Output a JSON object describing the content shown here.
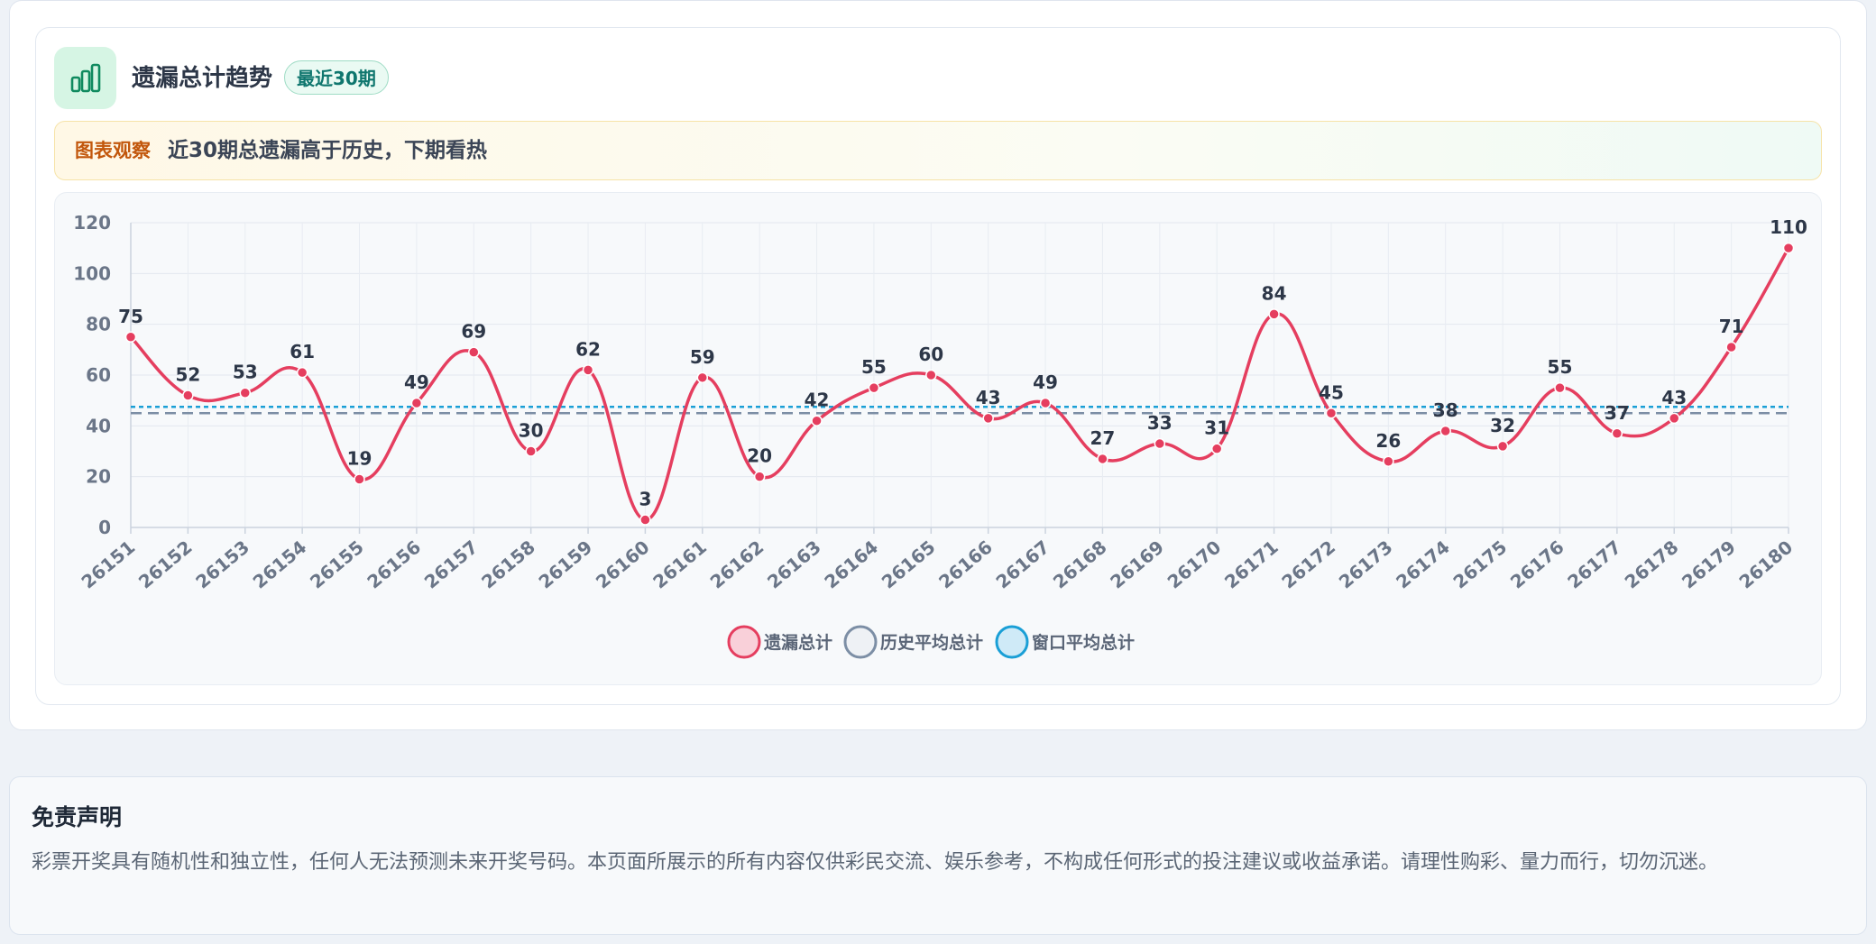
{
  "header": {
    "title": "遗漏总计趋势",
    "badge": "最近30期",
    "icon": "bar-chart-icon"
  },
  "observation": {
    "tag": "图表观察",
    "text": "近30期总遗漏高于历史，下期看热"
  },
  "chart_data": {
    "type": "line",
    "categories": [
      "26151",
      "26152",
      "26153",
      "26154",
      "26155",
      "26156",
      "26157",
      "26158",
      "26159",
      "26160",
      "26161",
      "26162",
      "26163",
      "26164",
      "26165",
      "26166",
      "26167",
      "26168",
      "26169",
      "26170",
      "26171",
      "26172",
      "26173",
      "26174",
      "26175",
      "26176",
      "26177",
      "26178",
      "26179",
      "26180"
    ],
    "series": [
      {
        "name": "遗漏总计",
        "values": [
          75,
          52,
          53,
          61,
          19,
          49,
          69,
          30,
          62,
          3,
          59,
          20,
          42,
          55,
          60,
          43,
          49,
          27,
          33,
          31,
          84,
          45,
          26,
          38,
          32,
          55,
          37,
          43,
          71,
          110
        ],
        "color": "#e53e5f",
        "style": "solid-curve"
      },
      {
        "name": "历史平均总计",
        "values": [
          45,
          45,
          45,
          45,
          45,
          45,
          45,
          45,
          45,
          45,
          45,
          45,
          45,
          45,
          45,
          45,
          45,
          45,
          45,
          45,
          45,
          45,
          45,
          45,
          45,
          45,
          45,
          45,
          45,
          45
        ],
        "color": "#7c8ea5",
        "style": "dashed"
      },
      {
        "name": "窗口平均总计",
        "values": [
          47.5,
          47.5,
          47.5,
          47.5,
          47.5,
          47.5,
          47.5,
          47.5,
          47.5,
          47.5,
          47.5,
          47.5,
          47.5,
          47.5,
          47.5,
          47.5,
          47.5,
          47.5,
          47.5,
          47.5,
          47.5,
          47.5,
          47.5,
          47.5,
          47.5,
          47.5,
          47.5,
          47.5,
          47.5,
          47.5
        ],
        "color": "#1a9fd6",
        "style": "dotted"
      }
    ],
    "yticks": [
      0,
      20,
      40,
      60,
      80,
      100,
      120
    ],
    "ylim": [
      0,
      120
    ],
    "grid": true,
    "legend": "bottom-center",
    "data_labels": true
  },
  "disclaimer": {
    "title": "免责声明",
    "text": "彩票开奖具有随机性和独立性，任何人无法预测未来开奖号码。本页面所展示的所有内容仅供彩民交流、娱乐参考，不构成任何形式的投注建议或收益承诺。请理性购彩、量力而行，切勿沉迷。"
  },
  "colors": {
    "accent": "#e53e5f",
    "badge_green": "#0f766e",
    "obs_orange": "#c2570c"
  }
}
